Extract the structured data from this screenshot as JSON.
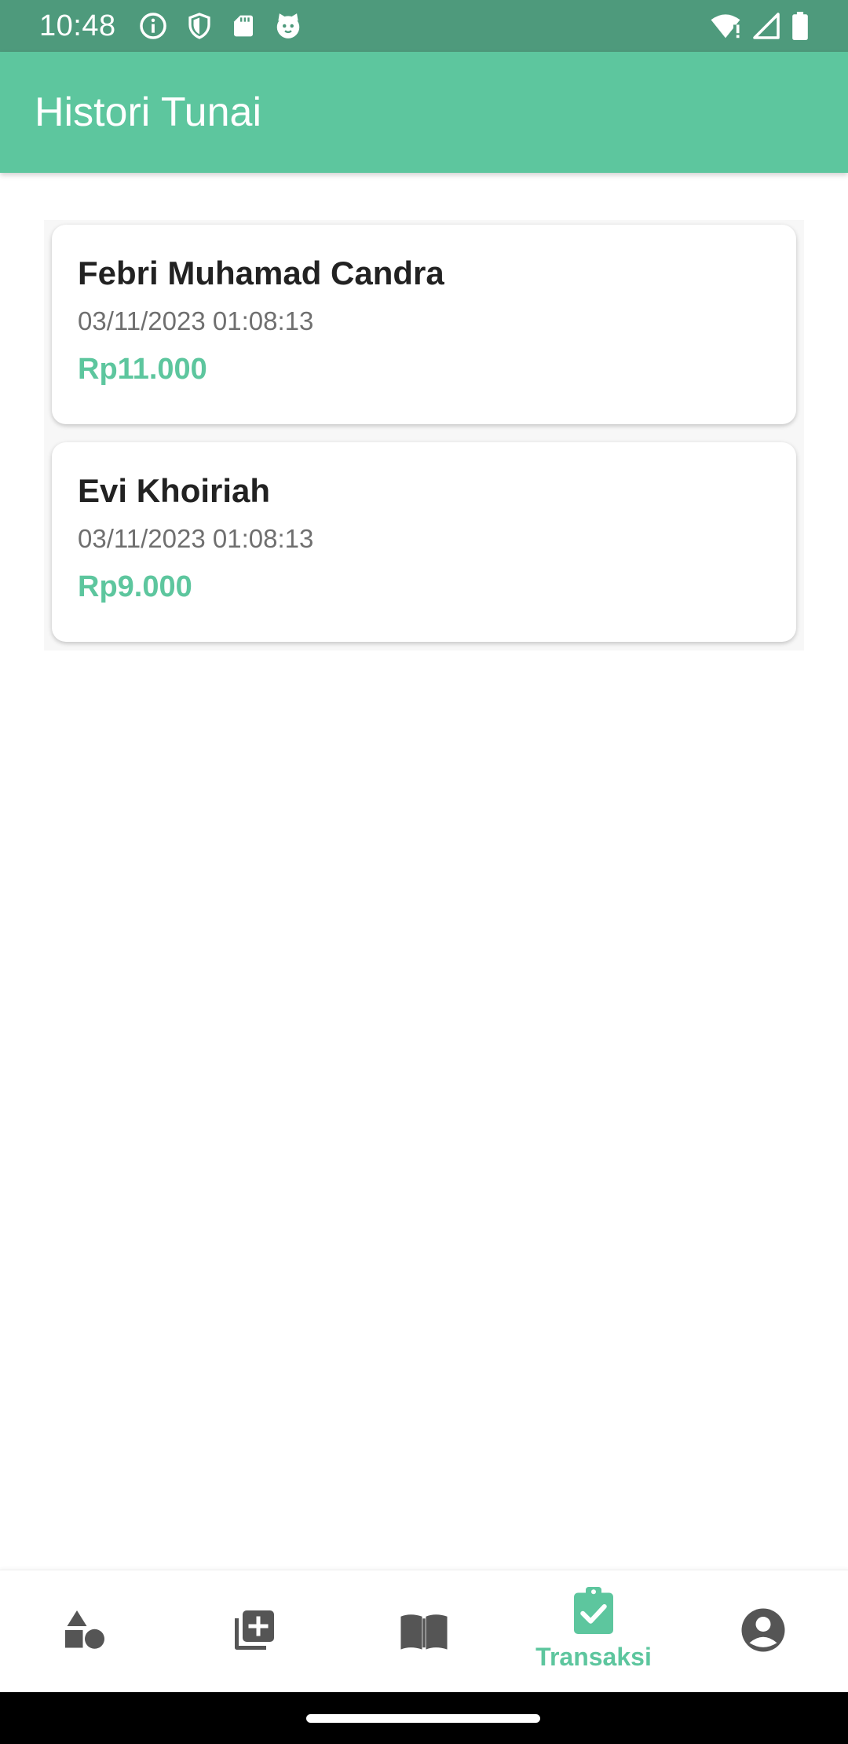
{
  "status_bar": {
    "time": "10:48",
    "left_icons": [
      "info-icon",
      "shield-icon",
      "sd-card-icon",
      "cat-face-icon"
    ],
    "right_icons": [
      "wifi-alert-icon",
      "signal-icon",
      "battery-icon"
    ]
  },
  "app_bar": {
    "title": "Histori Tunai"
  },
  "transactions": [
    {
      "name": "Febri Muhamad Candra",
      "datetime": "03/11/2023 01:08:13",
      "amount": "Rp11.000"
    },
    {
      "name": "Evi Khoiriah",
      "datetime": "03/11/2023 01:08:13",
      "amount": "Rp9.000"
    }
  ],
  "bottom_nav": {
    "items": [
      {
        "icon": "shapes-icon",
        "label": ""
      },
      {
        "icon": "add-box-icon",
        "label": ""
      },
      {
        "icon": "book-open-icon",
        "label": ""
      },
      {
        "icon": "clipboard-check-icon",
        "label": "Transaksi",
        "active": true
      },
      {
        "icon": "account-circle-icon",
        "label": ""
      }
    ]
  },
  "colors": {
    "status_bar": "#4e9a7c",
    "primary": "#5dc69e",
    "icon_inactive": "#555555",
    "text_primary": "#222222",
    "text_secondary": "#6f6f6f"
  }
}
